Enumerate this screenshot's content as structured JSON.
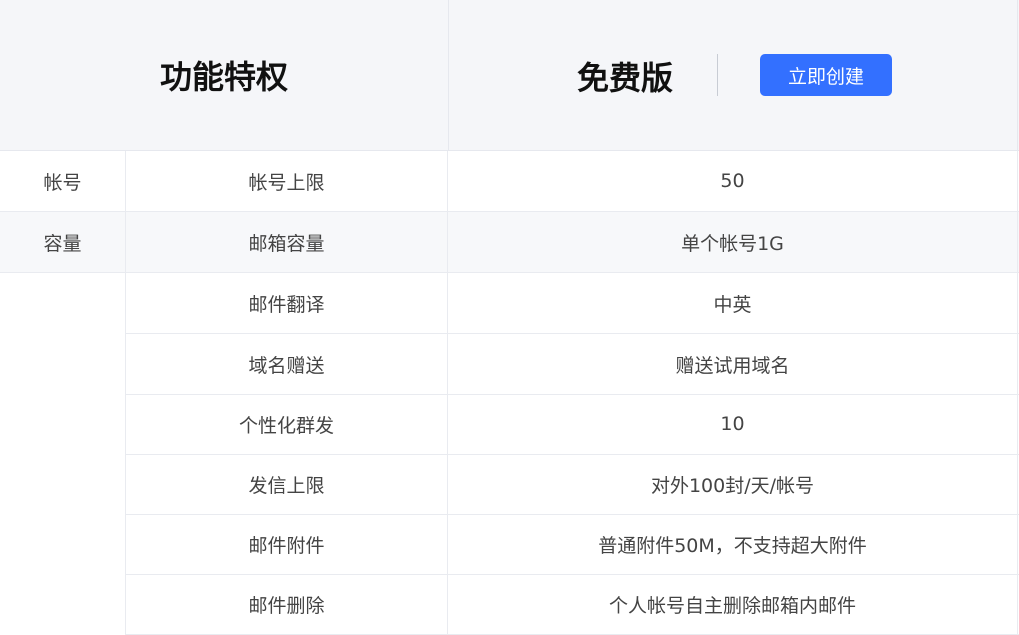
{
  "header": {
    "feature_title": "功能特权",
    "plan_name": "免费版",
    "create_button": "立即创建"
  },
  "colors": {
    "header_bg": "#f5f6f9",
    "accent": "#3370ff"
  },
  "rows": [
    {
      "category": "帐号",
      "feature": "帐号上限",
      "value": "50"
    },
    {
      "category": "容量",
      "feature": "邮箱容量",
      "value": "单个帐号1G"
    },
    {
      "category": "",
      "feature": "邮件翻译",
      "value": "中英"
    },
    {
      "category": "",
      "feature": "域名赠送",
      "value": "赠送试用域名"
    },
    {
      "category": "",
      "feature": "个性化群发",
      "value": "10"
    },
    {
      "category": "",
      "feature": "发信上限",
      "value": "对外100封/天/帐号"
    },
    {
      "category": "",
      "feature": "邮件附件",
      "value": "普通附件50M，不支持超大附件"
    },
    {
      "category": "",
      "feature": "邮件删除",
      "value": "个人帐号自主删除邮箱内邮件"
    }
  ]
}
